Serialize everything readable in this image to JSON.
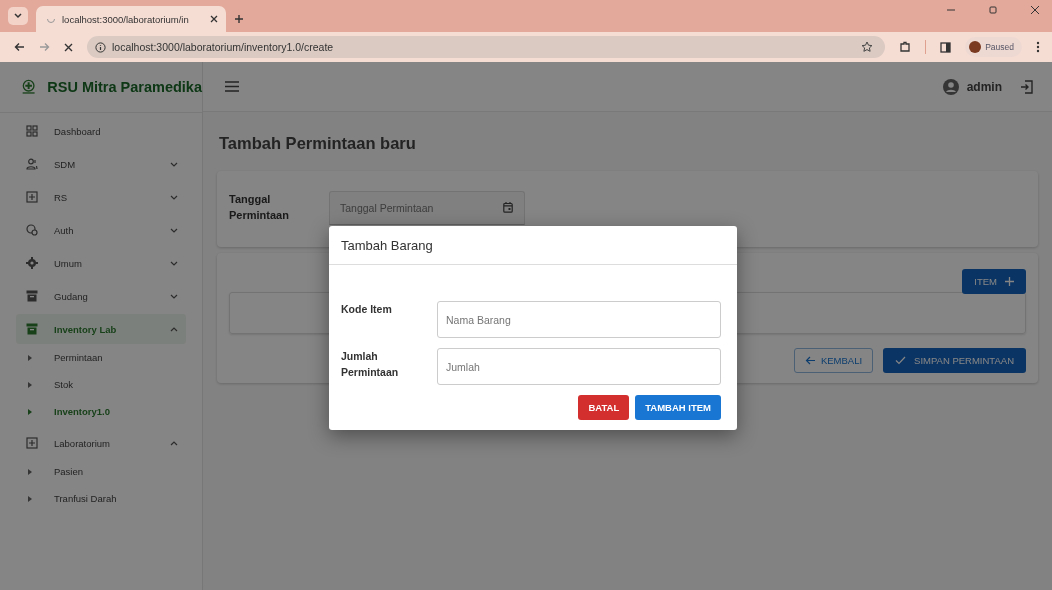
{
  "browser": {
    "tab_title": "localhost:3000/laboratorium/in",
    "url": "localhost:3000/laboratorium/inventory1.0/create",
    "profile": "Paused"
  },
  "app": {
    "brand": "RSU Mitra Paramedika",
    "user": "admin"
  },
  "sidebar": {
    "items": [
      {
        "label": "Dashboard",
        "kind": "link",
        "selected": false
      },
      {
        "label": "SDM",
        "kind": "group",
        "expanded": false,
        "selected": false
      },
      {
        "label": "RS",
        "kind": "group",
        "expanded": false,
        "selected": false
      },
      {
        "label": "Auth",
        "kind": "group",
        "expanded": false,
        "selected": false
      },
      {
        "label": "Umum",
        "kind": "group",
        "expanded": false,
        "selected": false
      },
      {
        "label": "Gudang",
        "kind": "group",
        "expanded": false,
        "selected": false
      },
      {
        "label": "Inventory Lab",
        "kind": "group",
        "expanded": true,
        "selected": true,
        "children": [
          {
            "label": "Permintaan",
            "selected": false
          },
          {
            "label": "Stok",
            "selected": false
          },
          {
            "label": "Inventory1.0",
            "selected": true
          }
        ]
      },
      {
        "label": "Laboratorium",
        "kind": "group",
        "expanded": true,
        "selected": false,
        "children": [
          {
            "label": "Pasien",
            "selected": false
          },
          {
            "label": "Tranfusi Darah",
            "selected": false
          }
        ]
      }
    ]
  },
  "page": {
    "title": "Tambah Permintaan baru",
    "date_label": "Tanggal Permintaan",
    "date_placeholder": "Tanggal Permintaan",
    "item_button": "ITEM",
    "back_button": "KEMBALI",
    "save_button": "SIMPAN PERMINTAAN"
  },
  "modal": {
    "title": "Tambah Barang",
    "fields": [
      {
        "label": "Kode Item",
        "placeholder": "Nama Barang"
      },
      {
        "label": "Jumlah Permintaan",
        "placeholder": "Jumlah"
      }
    ],
    "buttons": [
      {
        "label": "BATAL",
        "kind": "danger"
      },
      {
        "label": "TAMBAH ITEM",
        "kind": "primary"
      }
    ]
  }
}
